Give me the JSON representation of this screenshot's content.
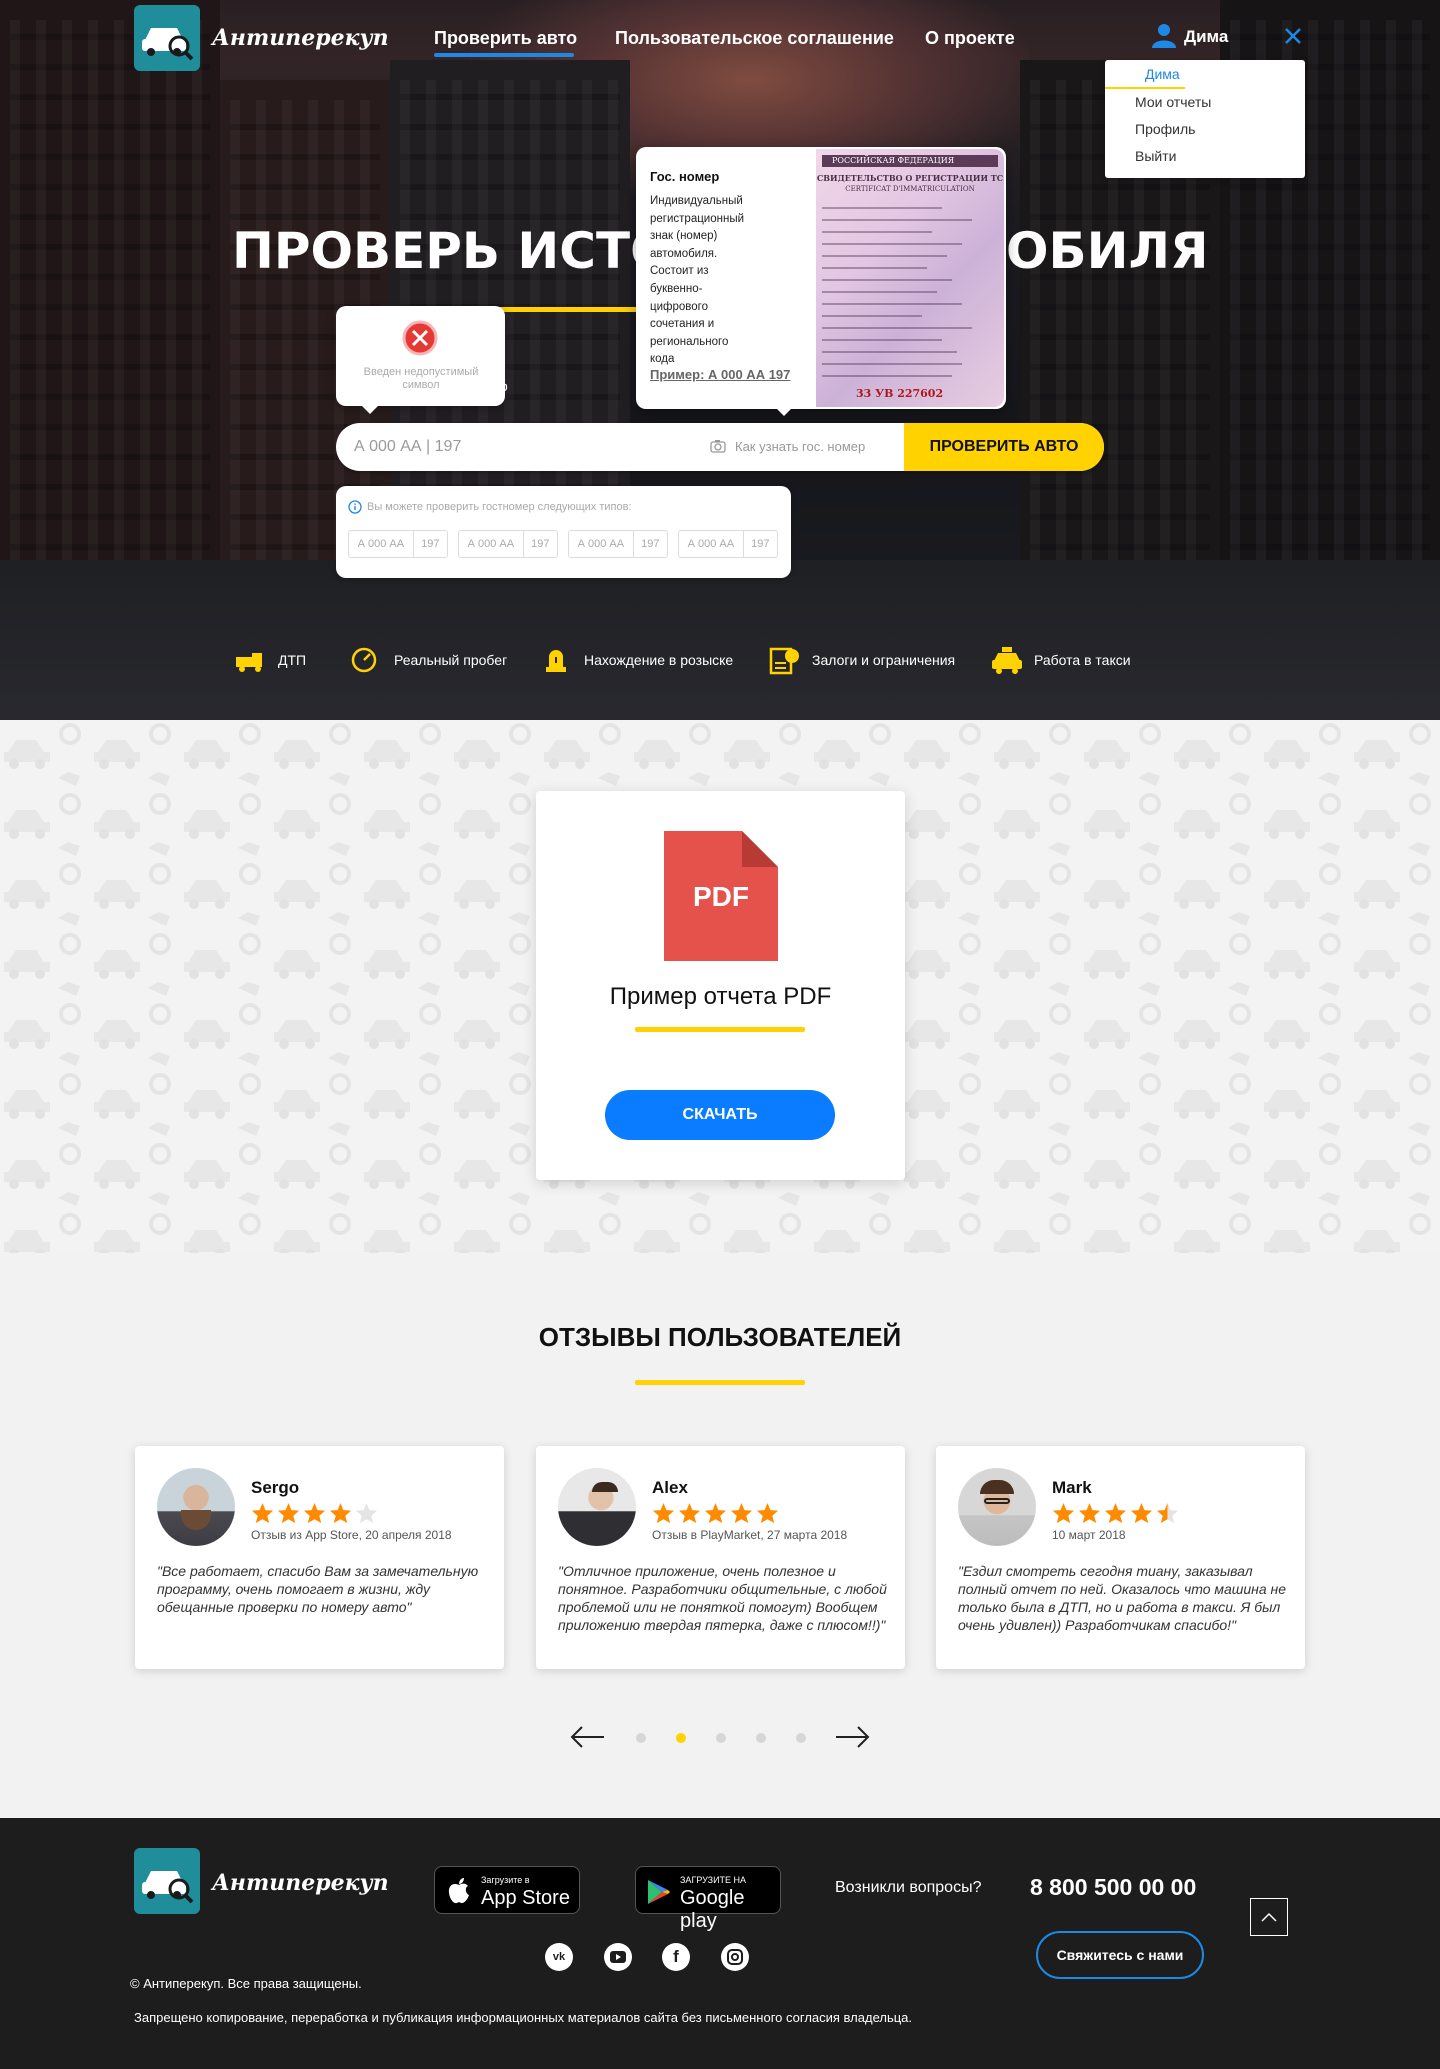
{
  "brand": {
    "name": "Антиперекуп"
  },
  "nav": {
    "items": [
      "Проверить авто",
      "Пользовательское соглашение",
      "О проекте"
    ],
    "user": "Дима"
  },
  "user_menu": {
    "items": [
      "Дима",
      "Мои отчеты",
      "Профиль",
      "Выйти"
    ]
  },
  "hero": {
    "headline_left": "ПРОВЕРЬ ИСТО",
    "headline_right": "ОБИЛЯ",
    "plate_tooltip": {
      "title": "Гос. номер",
      "body": "Индивидуальный регистрационный знак (номер) автомобиля. Состоит из буквенно-цифрового сочетания и регионального кода",
      "example": "Пример: А 000 АА 197",
      "doc_header": "РОССИЙСКАЯ ФЕДЕРАЦИЯ",
      "doc_title": "СВИДЕТЕЛЬСТВО О РЕГИСТРАЦИИ ТС",
      "doc_subtitle": "CERTIFICAT D'IMMATRICULATION",
      "doc_number": "33  УВ  227602"
    },
    "error_tooltip": {
      "text": "Введен недопустимый символ"
    },
    "search": {
      "placeholder": "А 000 АА | 197",
      "hint": "Как узнать  гос. номер",
      "button": "ПРОВЕРИТЬ АВТО"
    },
    "formats": {
      "info": "Вы можете проверить гостномер следующих типов:",
      "items": [
        {
          "plate": "А 000 АА",
          "region": "197"
        },
        {
          "plate": "А 000 АА",
          "region": "197"
        },
        {
          "plate": "А 000 АА",
          "region": "197"
        },
        {
          "plate": "А 000 АА",
          "region": "197"
        }
      ]
    },
    "features": [
      "ДТП",
      "Реальный пробег",
      "Нахождение в розыске",
      "Залоги и ограничения",
      "Работа в такси"
    ]
  },
  "pdf": {
    "icon_label": "PDF",
    "title": "Пример отчета PDF",
    "button": "СКАЧАТЬ",
    "accent": "#ffd200",
    "button_color": "#0a7cff"
  },
  "reviews": {
    "title": "ОТЗЫВЫ ПОЛЬЗОВАТЕЛЕЙ",
    "items": [
      {
        "name": "Sergo",
        "rating": 4,
        "source": "Отзыв из App Store, 20 апреля 2018",
        "text": "\"Все работает, спасибо Вам за замечательную программу, очень помогает в жизни, жду обещанные проверки по номеру авто\""
      },
      {
        "name": "Alex",
        "rating": 5,
        "source": "Отзыв в PlayMarket, 27 марта 2018",
        "text": "\"Отличное приложение, очень полезное и понятное. Разработчики общительные, с любой проблемой или не поняткой помогут) Вообщем приложению твердая пятерка, даже с плюсом!!)\""
      },
      {
        "name": "Mark",
        "rating": 4.5,
        "source": "10 март 2018",
        "text": "\"Ездил смотреть сегодня тиану, заказывал полный отчет по ней. Оказалось что машина не только была в ДТП, но и работа в такси. Я был очень удивлен)) Разработчикам спасибо!\""
      }
    ],
    "pagination": {
      "count": 5,
      "active": 2
    },
    "star_color": "#ff8a00"
  },
  "footer": {
    "appstore_small": "Загрузите в",
    "appstore_big": "App Store",
    "gplay_small": "ЗАГРУЗИТЕ НА",
    "gplay_big": "Google play",
    "question": "Возникли вопросы?",
    "phone": "8 800 500 00 00",
    "contact_button": "Свяжитесь с нами",
    "copyright": "© Антиперекуп. Все права защищены.",
    "disclaimer": "Запрещено копирование, переработка и публикация информационных материалов сайта без письменного согласия владельца.",
    "social": [
      "vk-icon",
      "youtube-icon",
      "facebook-icon",
      "instagram-icon"
    ]
  }
}
